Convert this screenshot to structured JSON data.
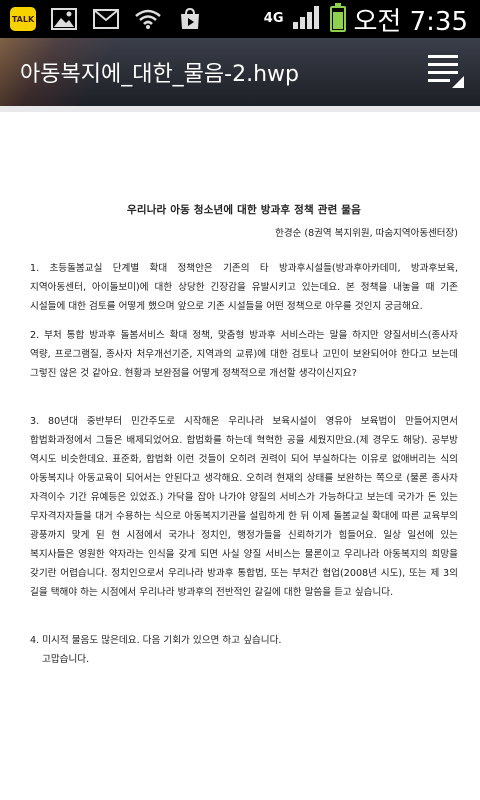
{
  "status_bar": {
    "notification_icons": [
      "kakaotalk-icon",
      "gallery-icon",
      "mail-icon",
      "wifi-icon",
      "play-store-icon"
    ],
    "kakao_label": "TALK",
    "network": "4G",
    "clock": "오전 7:35",
    "battery_level": 0.85
  },
  "title_bar": {
    "title": "아동복지에_대한_물음-2.hwp",
    "menu_icon": "menu-icon"
  },
  "document": {
    "title": "우리나라 아동 청소년에 대한 방과후 정책 관련 물음",
    "author": "한경순 (8권역 복지위원, 따숨지역아동센터장)",
    "paragraphs": [
      "1. 초등돌봄교실 단계별 확대 정책안은 기존의 타 방과후시설들(방과후아카데미, 방과후보육, 지역아동센터, 아이돌보미)에 대한 상당한 긴장감을 유발시키고 있는데요. 본 정책을 내놓을 때 기존 시설들에 대한 검토를 어떻게 했으며 앞으로 기존 시설들을 어떤 정책으로 아우를 것인지 궁금해요.",
      "2. 부처 통합 방과후 돌봄서비스 확대 정책, 맞춤형 방과후 서비스라는 말을 하지만 양질서비스(종사자 역량, 프로그램질, 종사자 처우개선기준, 지역과의 교류)에 대한 검토나 고민이 보완되어야 한다고 보는데 그렇진 않은 것 같아요. 현황과 보완점을 어떻게 정책적으로 개선할 생각이신지요?",
      "3. 80년대 중반부터 민간주도로 시작해온 우리나라 보육시설이 영유아 보육법이 만들어지면서 합법화과정에서 그들은 배제되었어요. 합법화를 하는데 혁혁한 공을 세웠지만요.(제 경우도 해당). 공부방 역시도 비슷한데요. 표준화, 합법화 이런 것들이 오히려 권력이 되어 부실하다는 이유로 없애버리는 식의 아동복지나 아동교육이 되어서는 안된다고 생각해요. 오히려 현재의 상태를 보완하는 쪽으로 (물론 종사자 자격이수 기간 유예등은 있었죠.) 가닥을 잡아 나가야 양질의 서비스가 가능하다고 보는데 국가가 돈 있는 무자격자자들을 대거 수용하는 식으로 아동복지기관을 설립하게 한 뒤 이제 돌봄교실 확대에 따른 교육부의 광풍까지 맞게 된 현 시점에서 국가나 정치인, 행정가들을 신뢰하기가 힘들어요. 일상 일선에 있는 복지사들은 영원한 약자라는 인식을 갖게 되면 사실 양질 서비스는 물론이고 우리나라 아동복지의 희망을 갖기란 어렵습니다. 정치인으로서 우리나라 방과후 통합법, 또는 부처간 협업(2008년 시도), 또는 제 3의 길을 택해야 하는 시점에서 우리나라 방과후의 전반적인 갈길에 대한 말씀을 듣고 싶습니다.",
      "4. 미시적 물음도 많은데요. 다음 기회가 있으면 하고 싶습니다."
    ],
    "closing": "고맙습니다."
  }
}
